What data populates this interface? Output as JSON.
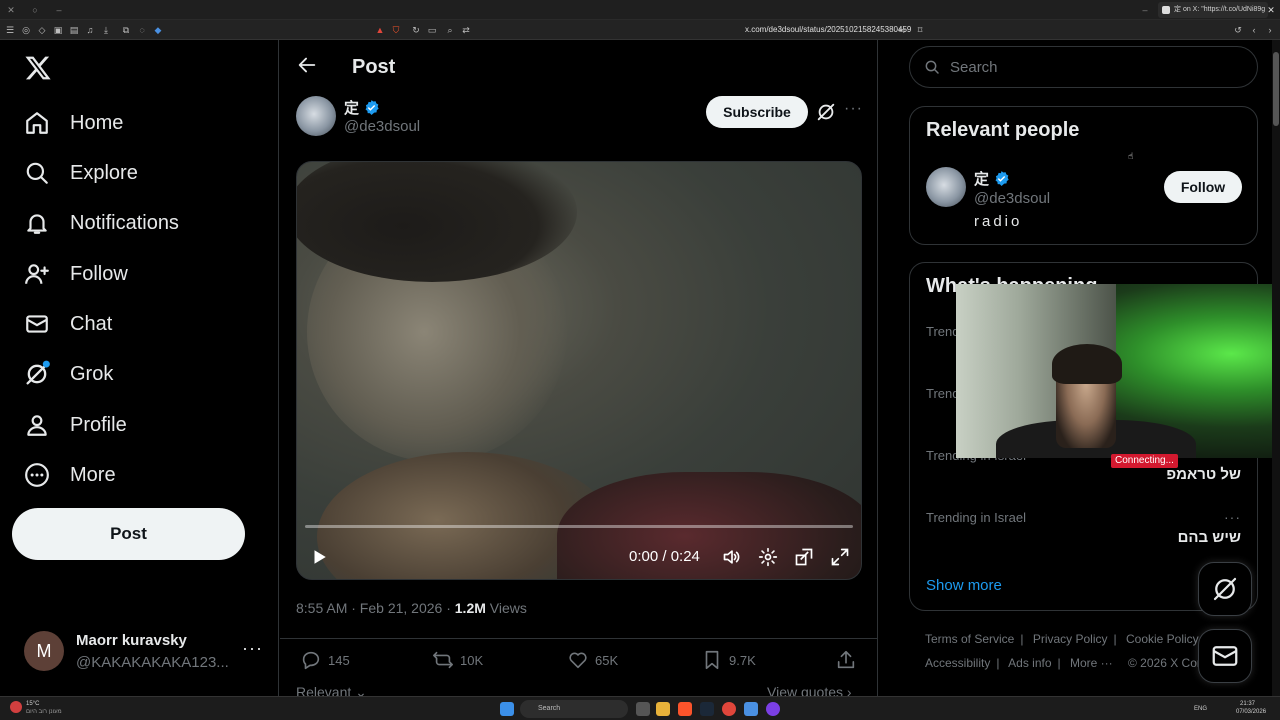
{
  "browser": {
    "tab_title": "定 on X: \"https://t.co/UdNi89g",
    "url": "x.com/de3dsoul/status/2025102158245380459"
  },
  "sidebar": {
    "items": [
      {
        "label": "Home",
        "icon": "home-icon"
      },
      {
        "label": "Explore",
        "icon": "search-icon"
      },
      {
        "label": "Notifications",
        "icon": "bell-icon"
      },
      {
        "label": "Follow",
        "icon": "add-user-icon"
      },
      {
        "label": "Chat",
        "icon": "mail-icon"
      },
      {
        "label": "Grok",
        "icon": "grok-icon"
      },
      {
        "label": "Profile",
        "icon": "person-icon"
      },
      {
        "label": "More",
        "icon": "more-circle-icon"
      }
    ],
    "post_button": "Post",
    "account": {
      "initial": "M",
      "name": "Maorr kuravsky",
      "handle": "@KAKAKAKAKA123..."
    }
  },
  "post": {
    "header_title": "Post",
    "author": {
      "name": "定",
      "handle": "@de3dsoul"
    },
    "subscribe_label": "Subscribe",
    "video": {
      "time": "0:00 / 0:24",
      "progress": 0.0
    },
    "timestamp": "8:55 AM · Feb 21, 2026 · ",
    "views_count": "1.2M",
    "views_label": " Views",
    "stats": {
      "replies": "145",
      "reposts": "10K",
      "likes": "65K",
      "bookmarks": "9.7K"
    },
    "relevant_label": "Relevant",
    "view_quotes_label": "View quotes"
  },
  "right": {
    "search_placeholder": "Search",
    "relevant_people": {
      "title": "Relevant people",
      "name": "定",
      "handle": "@de3dsoul",
      "bio": "radio",
      "follow_label": "Follow"
    },
    "whats_happening": {
      "title": "What's happening",
      "trends": [
        {
          "context": "Trend",
          "title": ""
        },
        {
          "context": "Trend",
          "title": ""
        },
        {
          "context": "Trending in Israel",
          "title": "של טראמפ"
        },
        {
          "context": "Trending in Israel",
          "title": "שיש בהם"
        }
      ],
      "show_more": "Show more"
    },
    "footer": {
      "links1": [
        "Terms of Service",
        "Privacy Policy",
        "Cookie Policy"
      ],
      "links2": [
        "Accessibility",
        "Ads info",
        "More ···",
        "© 2026 X Corp."
      ]
    }
  },
  "overlay": {
    "connecting": "Connecting..."
  },
  "taskbar": {
    "weather_temp": "15°C",
    "weather_text": "מעונן רוב היום",
    "search_placeholder": "Search",
    "time": "21:37",
    "date": "07/03/2026",
    "lang": "ENG"
  }
}
